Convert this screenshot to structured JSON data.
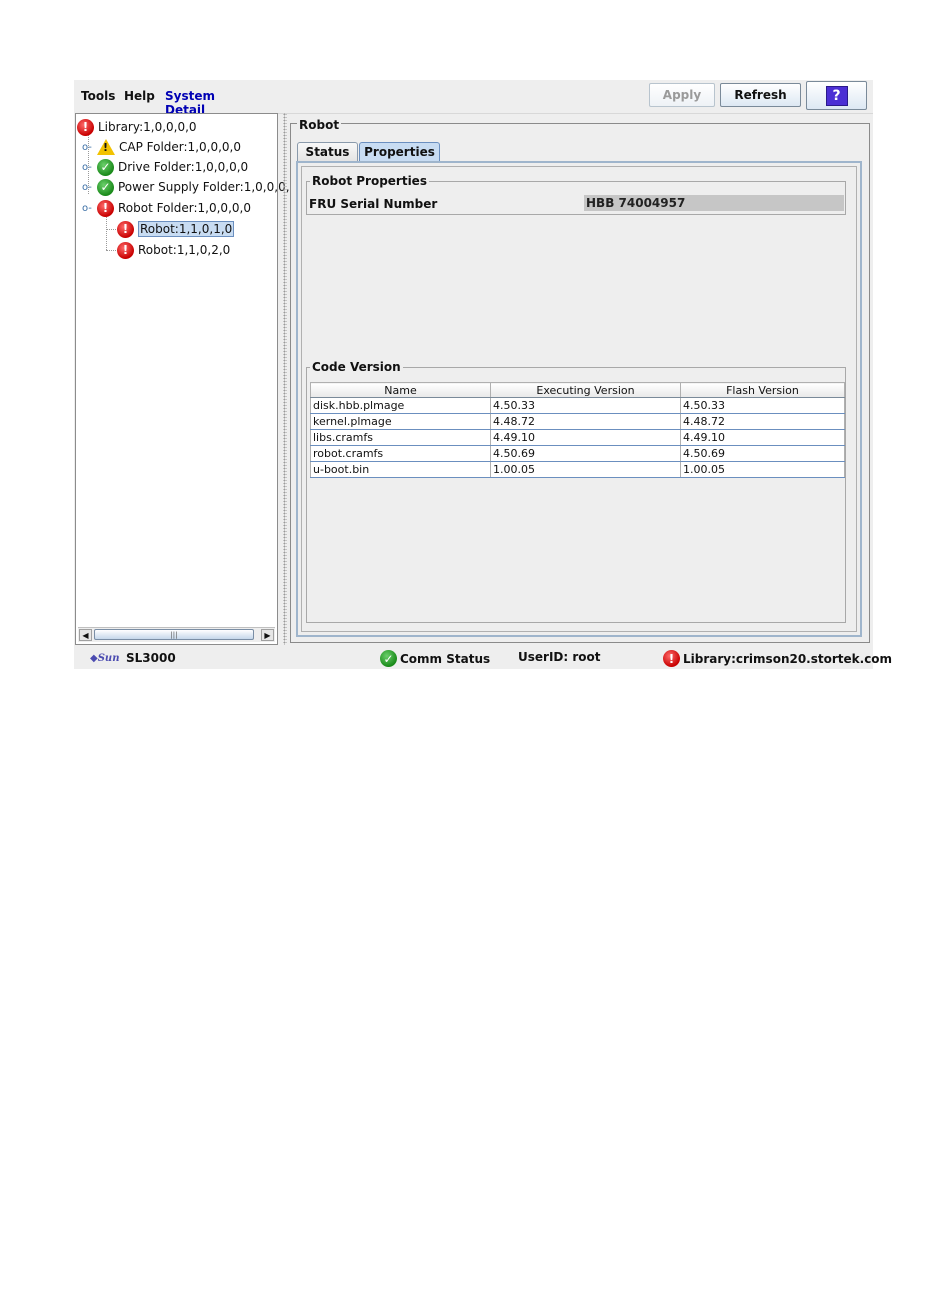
{
  "menu": {
    "items": [
      "Tools",
      "Help",
      "System Detail"
    ]
  },
  "toolbar": {
    "apply_label": "Apply",
    "refresh_label": "Refresh",
    "help_label": "?"
  },
  "tree": {
    "root": "Library:1,0,0,0,0",
    "items": [
      {
        "label": "CAP Folder:1,0,0,0,0",
        "status": "warning"
      },
      {
        "label": "Drive Folder:1,0,0,0,0",
        "status": "ok"
      },
      {
        "label": "Power Supply Folder:1,0,0,0,",
        "status": "ok"
      },
      {
        "label": "Robot Folder:1,0,0,0,0",
        "status": "error"
      }
    ],
    "children": [
      {
        "label": "Robot:1,1,0,1,0",
        "status": "error",
        "selected": true
      },
      {
        "label": "Robot:1,1,0,2,0",
        "status": "error"
      }
    ]
  },
  "detail": {
    "title": "Robot",
    "tabs": [
      "Status",
      "Properties"
    ],
    "selected_tab": "Properties",
    "properties": {
      "group_title": "Robot Properties",
      "fru_label": "FRU Serial Number",
      "fru_value": "HBB  74004957"
    },
    "code_version": {
      "group_title": "Code Version",
      "columns": [
        "Name",
        "Executing Version",
        "Flash Version"
      ],
      "rows": [
        [
          "disk.hbb.plmage",
          "4.50.33",
          "4.50.33"
        ],
        [
          "kernel.plmage",
          "4.48.72",
          "4.48.72"
        ],
        [
          "libs.cramfs",
          "4.49.10",
          "4.49.10"
        ],
        [
          "robot.cramfs",
          "4.50.69",
          "4.50.69"
        ],
        [
          "u-boot.bin",
          "1.00.05",
          "1.00.05"
        ]
      ]
    }
  },
  "statusbar": {
    "product": "SL3000",
    "logo_text": "Sun",
    "comm_status": "Comm Status",
    "user": "UserID: root",
    "library": "Library:crimson20.stortek.com"
  },
  "colors": {
    "error": "#c80000",
    "ok": "#1a8a1a",
    "warning": "#f2c200",
    "active_menu": "#0000b4"
  }
}
